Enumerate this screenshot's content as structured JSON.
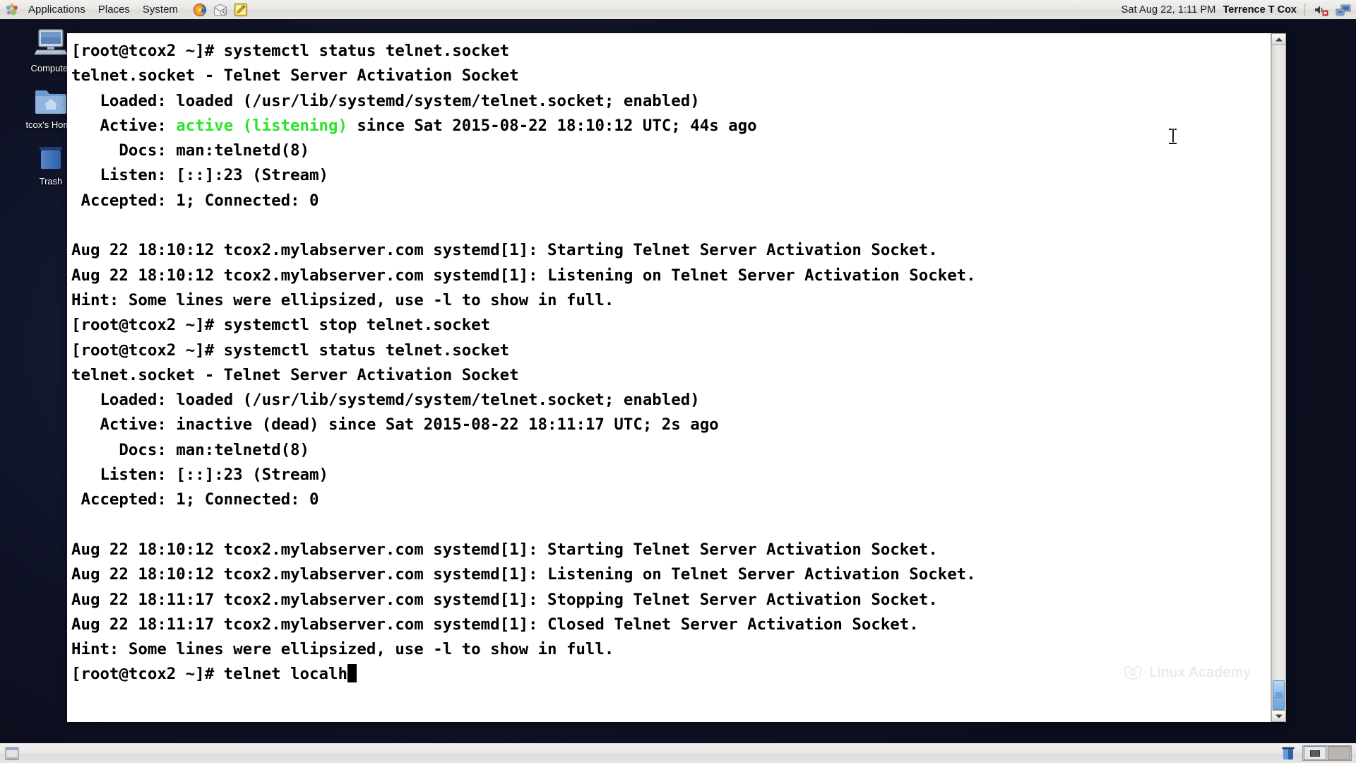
{
  "top_panel": {
    "menus": [
      "Applications",
      "Places",
      "System"
    ],
    "launchers": [
      {
        "name": "firefox-icon",
        "title": "Firefox Web Browser"
      },
      {
        "name": "evolution-icon",
        "title": "Evolution Mail"
      },
      {
        "name": "gedit-icon",
        "title": "Text Editor"
      }
    ],
    "clock": "Sat Aug 22,  1:11 PM",
    "username": "Terrence T Cox",
    "tray": [
      {
        "name": "volume-muted-icon"
      },
      {
        "name": "network-connection-icon"
      }
    ]
  },
  "desktop_icons": [
    {
      "name": "computer-icon",
      "label": "Computer"
    },
    {
      "name": "home-folder-icon",
      "label": "tcox's Home"
    },
    {
      "name": "trash-icon",
      "label": "Trash"
    }
  ],
  "terminal": {
    "watermark": "Linux Academy",
    "cursor_char": "█",
    "colors": {
      "background": "#ffffff",
      "foreground": "#000000",
      "active_green": "#29e529"
    },
    "lines": [
      {
        "text": "[root@tcox2 ~]# systemctl status telnet.socket"
      },
      {
        "text": "telnet.socket - Telnet Server Activation Socket"
      },
      {
        "text": "   Loaded: loaded (/usr/lib/systemd/system/telnet.socket; enabled)"
      },
      {
        "segments": [
          {
            "text": "   Active: ",
            "color": "default"
          },
          {
            "text": "active (listening)",
            "color": "green"
          },
          {
            "text": " since Sat 2015-08-22 18:10:12 UTC; 44s ago",
            "color": "default"
          }
        ]
      },
      {
        "text": "     Docs: man:telnetd(8)"
      },
      {
        "text": "   Listen: [::]:23 (Stream)"
      },
      {
        "text": " Accepted: 1; Connected: 0"
      },
      {
        "text": ""
      },
      {
        "text": "Aug 22 18:10:12 tcox2.mylabserver.com systemd[1]: Starting Telnet Server Activation Socket."
      },
      {
        "text": "Aug 22 18:10:12 tcox2.mylabserver.com systemd[1]: Listening on Telnet Server Activation Socket."
      },
      {
        "text": "Hint: Some lines were ellipsized, use -l to show in full."
      },
      {
        "text": "[root@tcox2 ~]# systemctl stop telnet.socket"
      },
      {
        "text": "[root@tcox2 ~]# systemctl status telnet.socket"
      },
      {
        "text": "telnet.socket - Telnet Server Activation Socket"
      },
      {
        "text": "   Loaded: loaded (/usr/lib/systemd/system/telnet.socket; enabled)"
      },
      {
        "text": "   Active: inactive (dead) since Sat 2015-08-22 18:11:17 UTC; 2s ago"
      },
      {
        "text": "     Docs: man:telnetd(8)"
      },
      {
        "text": "   Listen: [::]:23 (Stream)"
      },
      {
        "text": " Accepted: 1; Connected: 0"
      },
      {
        "text": ""
      },
      {
        "text": "Aug 22 18:10:12 tcox2.mylabserver.com systemd[1]: Starting Telnet Server Activation Socket."
      },
      {
        "text": "Aug 22 18:10:12 tcox2.mylabserver.com systemd[1]: Listening on Telnet Server Activation Socket."
      },
      {
        "text": "Aug 22 18:11:17 tcox2.mylabserver.com systemd[1]: Stopping Telnet Server Activation Socket."
      },
      {
        "text": "Aug 22 18:11:17 tcox2.mylabserver.com systemd[1]: Closed Telnet Server Activation Socket."
      },
      {
        "text": "Hint: Some lines were ellipsized, use -l to show in full."
      },
      {
        "text": "[root@tcox2 ~]# telnet localh",
        "cursor": true
      }
    ]
  },
  "bottom_panel": {
    "show_desktop": "Show Desktop",
    "trash_applet": "Trash",
    "workspaces": [
      {
        "name": "workspace-1",
        "active": true
      },
      {
        "name": "workspace-2",
        "active": false
      }
    ]
  }
}
